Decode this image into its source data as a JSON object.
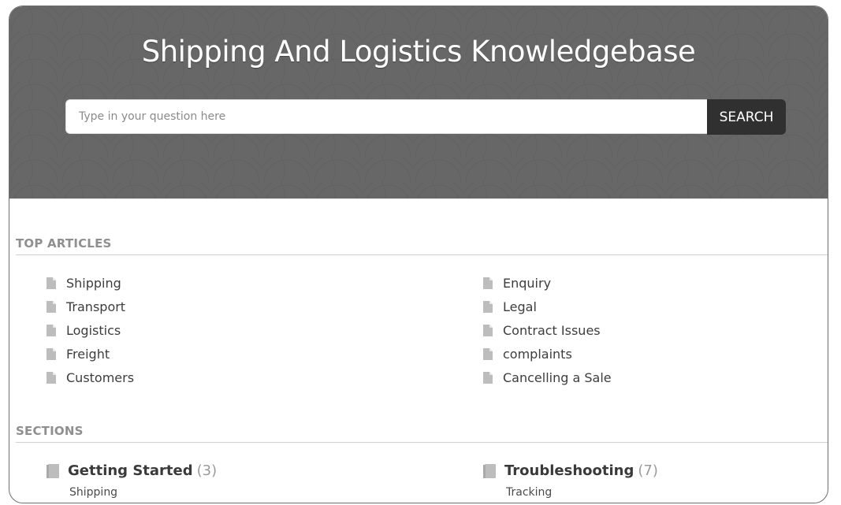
{
  "header": {
    "title": "Shipping And Logistics Knowledgebase",
    "search_placeholder": "Type in your question here",
    "search_value": "",
    "search_button_label": "SEARCH"
  },
  "top_articles": {
    "heading": "TOP ARTICLES",
    "left": [
      {
        "label": "Shipping",
        "icon": "document-icon"
      },
      {
        "label": "Transport",
        "icon": "document-icon"
      },
      {
        "label": "Logistics",
        "icon": "document-icon"
      },
      {
        "label": "Freight",
        "icon": "document-icon"
      },
      {
        "label": "Customers",
        "icon": "document-icon"
      }
    ],
    "right": [
      {
        "label": "Enquiry",
        "icon": "document-icon"
      },
      {
        "label": "Legal",
        "icon": "document-icon"
      },
      {
        "label": "Contract Issues",
        "icon": "document-icon"
      },
      {
        "label": "complaints",
        "icon": "document-icon"
      },
      {
        "label": "Cancelling a Sale",
        "icon": "document-icon"
      }
    ]
  },
  "sections": {
    "heading": "SECTIONS",
    "items": [
      {
        "title": "Getting Started",
        "count": "(3)",
        "first_article": "Shipping",
        "icon": "book-icon"
      },
      {
        "title": "Troubleshooting",
        "count": "(7)",
        "first_article": "Tracking",
        "icon": "book-icon"
      }
    ]
  },
  "colors": {
    "hero_bg": "#676767",
    "search_button_bg": "#303030",
    "heading_gray": "#8f8f8f",
    "icon_gray": "#bdbdbd"
  }
}
